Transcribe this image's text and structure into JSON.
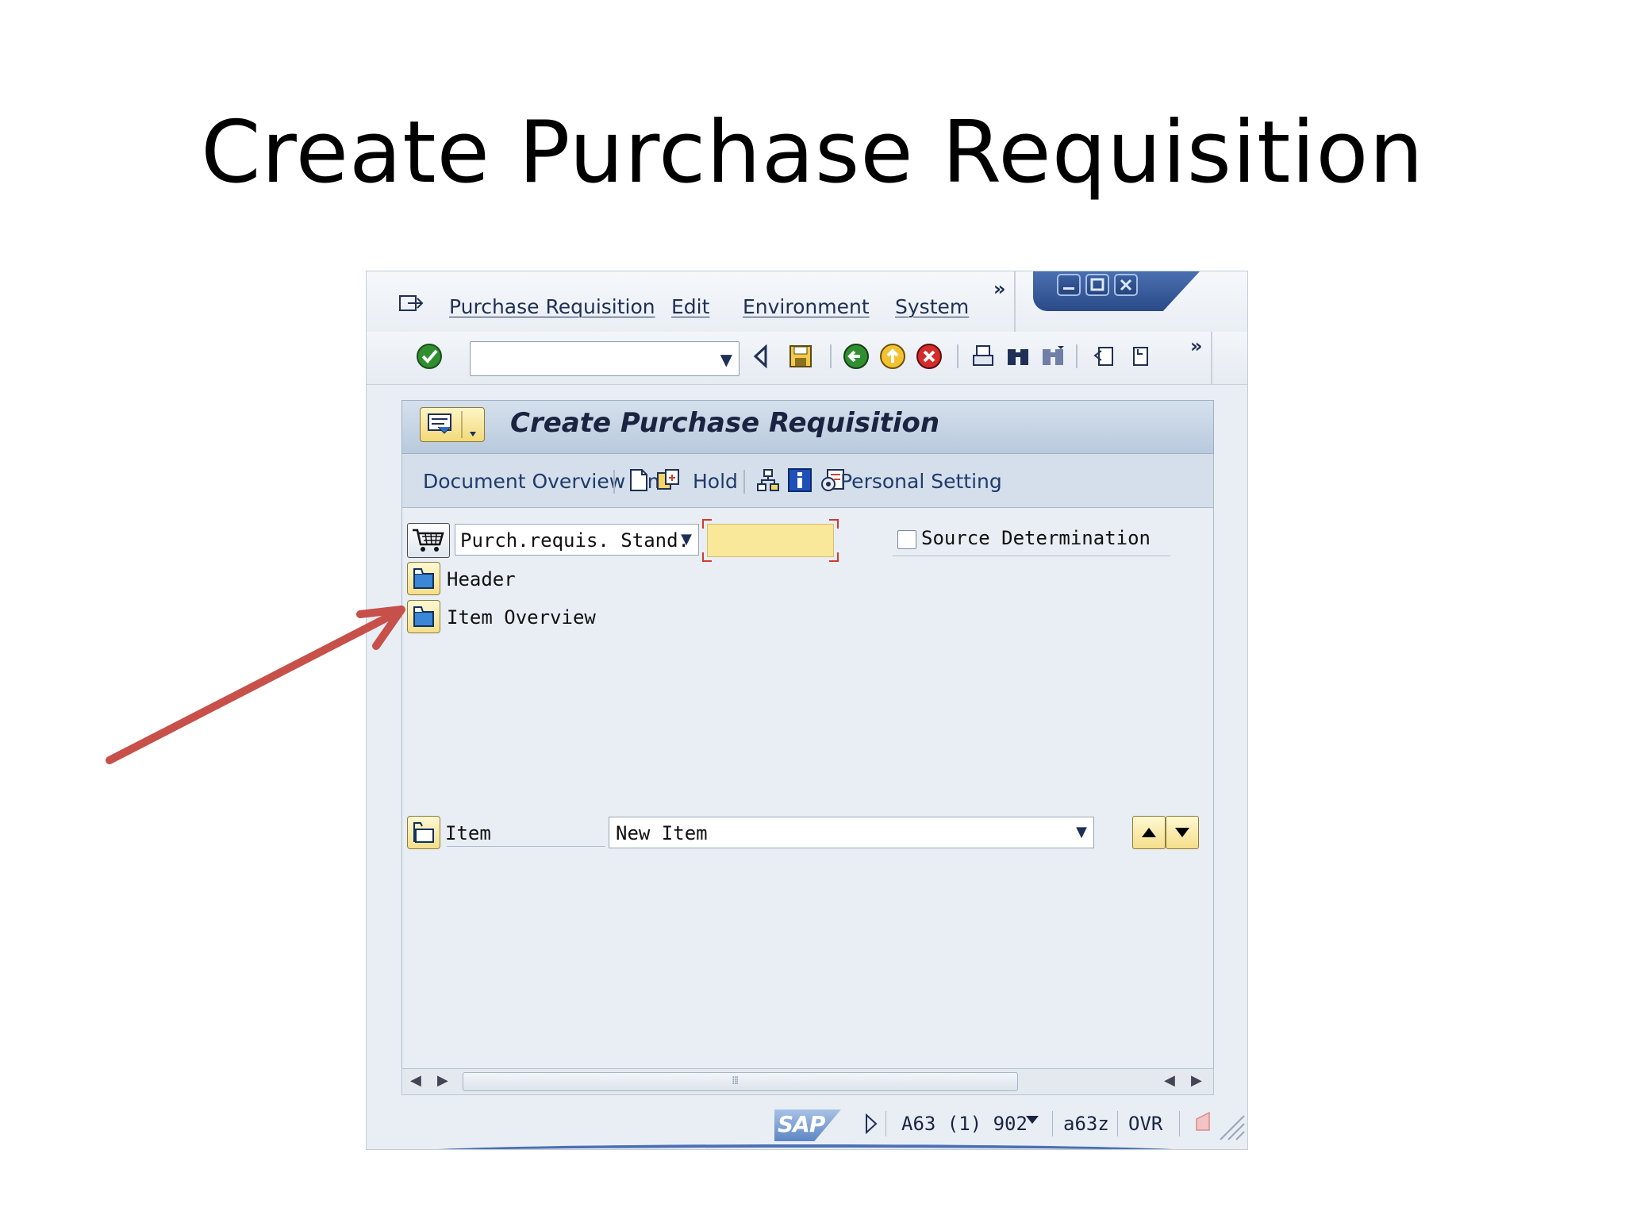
{
  "slide": {
    "title": "Create Purchase Requisition"
  },
  "window": {
    "menu": [
      {
        "label": "Purchase Requisition"
      },
      {
        "label": "Edit"
      },
      {
        "label": "Environment"
      },
      {
        "label": "System"
      }
    ],
    "menu_more": "»",
    "toolbar_more": "»"
  },
  "screen": {
    "title": "Create Purchase Requisition",
    "app_toolbar": {
      "document_overview": "Document Overview On",
      "hold": "Hold",
      "personal_setting": "Personal Setting"
    },
    "document_type": {
      "value": "Purch.requis. Stand."
    },
    "requisition_number": {
      "value": ""
    },
    "source_determination": {
      "label": "Source Determination",
      "checked": false
    },
    "sections": {
      "header": "Header",
      "item_overview": "Item Overview"
    },
    "item": {
      "label": "Item",
      "selected": "New Item"
    }
  },
  "statusbar": {
    "logo": "SAP",
    "system": "A63 (1) 902",
    "server": "a63z",
    "mode": "OVR"
  },
  "colors": {
    "annotation_arrow": "#c8504a",
    "input_required_bg": "#f9e79a",
    "title_bar": "#c7d5e6"
  }
}
